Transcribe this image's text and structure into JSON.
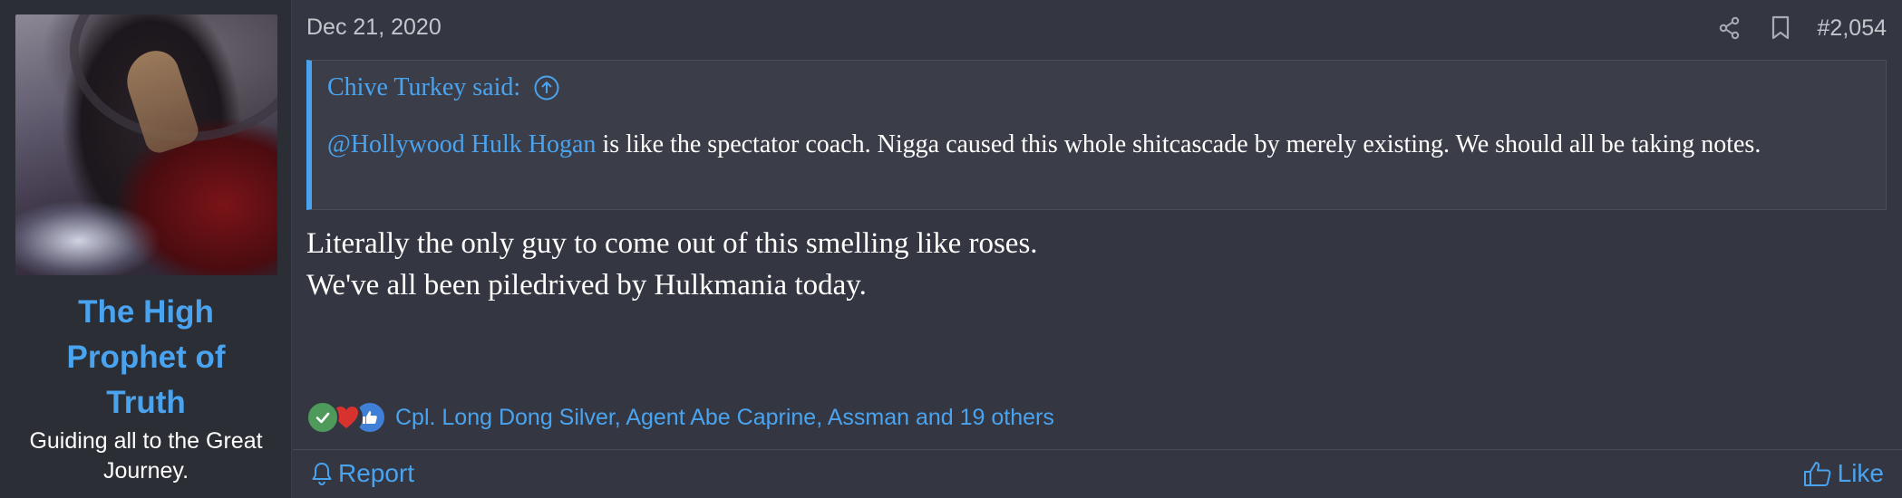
{
  "user": {
    "name": "The High Prophet of Truth",
    "title": "Guiding all to the Great Journey."
  },
  "post": {
    "date": "Dec 21, 2020",
    "number": "#2,054",
    "quote": {
      "author": "Chive Turkey said:",
      "mention": "@Hollywood Hulk Hogan",
      "text": " is like the spectator coach. Nigga caused this whole shitcascade by merely existing. We should all be taking notes."
    },
    "message_lines": [
      "Literally the only guy to come out of this smelling like roses.",
      "We've all been piledrived by Hulkmania today."
    ],
    "reactions": {
      "icons": [
        "agree-icon",
        "love-icon",
        "like-icon"
      ],
      "users_text": "Cpl. Long Dong Silver, Agent Abe Caprine, Assman and 19 others"
    }
  },
  "actions": {
    "report_label": "Report",
    "like_label": "Like"
  },
  "colors": {
    "accent": "#4aa3ef",
    "background": "#343741",
    "sidebar": "#2c2e36"
  }
}
